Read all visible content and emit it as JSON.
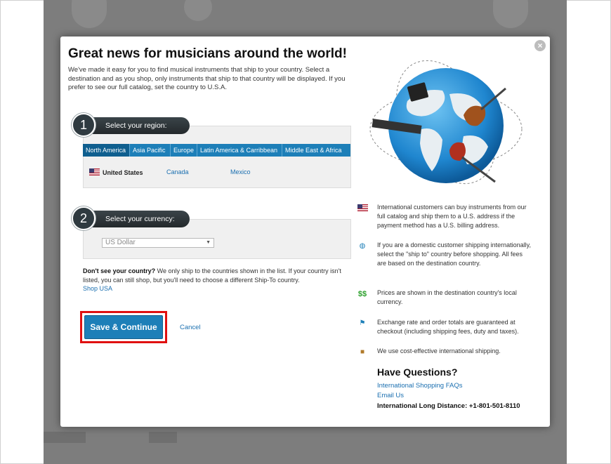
{
  "modal": {
    "title": "Great news for musicians around the world!",
    "intro": "We've made it easy for you to find musical instruments that ship to your country. Select a destination and as you shop, only instruments that ship to that country will be displayed. If you prefer to see our full catalog, set the country to U.S.A.",
    "close_label": "×"
  },
  "step1": {
    "number": "1",
    "label": "Select your region:",
    "tabs": [
      {
        "label": "North America",
        "active": true
      },
      {
        "label": "Asia Pacific",
        "active": false
      },
      {
        "label": "Europe",
        "active": false
      },
      {
        "label": "Latin America & Carribbean",
        "active": false
      },
      {
        "label": "Middle East & Africa",
        "active": false
      }
    ],
    "countries": [
      {
        "label": "United States",
        "selected": true
      },
      {
        "label": "Canada",
        "selected": false
      },
      {
        "label": "Mexico",
        "selected": false
      }
    ]
  },
  "step2": {
    "number": "2",
    "label": "Select your currency:",
    "currency_value": "US Dollar"
  },
  "dont_see": {
    "bold": "Don't see your country?",
    "text": " We only ship to the countries shown in the list. If your country isn't listed, you can still shop, but you'll need to choose a different Ship-To country.",
    "link": "Shop USA"
  },
  "actions": {
    "save_label": "Save & Continue",
    "cancel_label": "Cancel"
  },
  "info": [
    {
      "icon": "us-flag-icon",
      "text": "International customers can buy instruments from our full catalog and ship them to a U.S. address if the payment method has a U.S. billing address."
    },
    {
      "icon": "globe-icon",
      "text": "If you are a domestic customer shipping internationally, select the \"ship to\" country before shopping. All fees are based on the destination country."
    },
    {
      "icon": "dollar-icon",
      "text": "Prices are shown in the destination country's local currency."
    },
    {
      "icon": "flag-icon",
      "text": "Exchange rate and order totals are guaranteed at checkout (including shipping fees, duty and taxes)."
    },
    {
      "icon": "package-icon",
      "text": "We use cost-effective international shipping."
    }
  ],
  "questions": {
    "title": "Have Questions?",
    "faq_link": "International Shopping FAQs",
    "email_link": "Email Us",
    "phone": "International Long Distance: +1-801-501-8110"
  },
  "colors": {
    "accent": "#1d7fb8",
    "highlight_outline": "#e01010",
    "step_badge": "#2f3a40"
  }
}
